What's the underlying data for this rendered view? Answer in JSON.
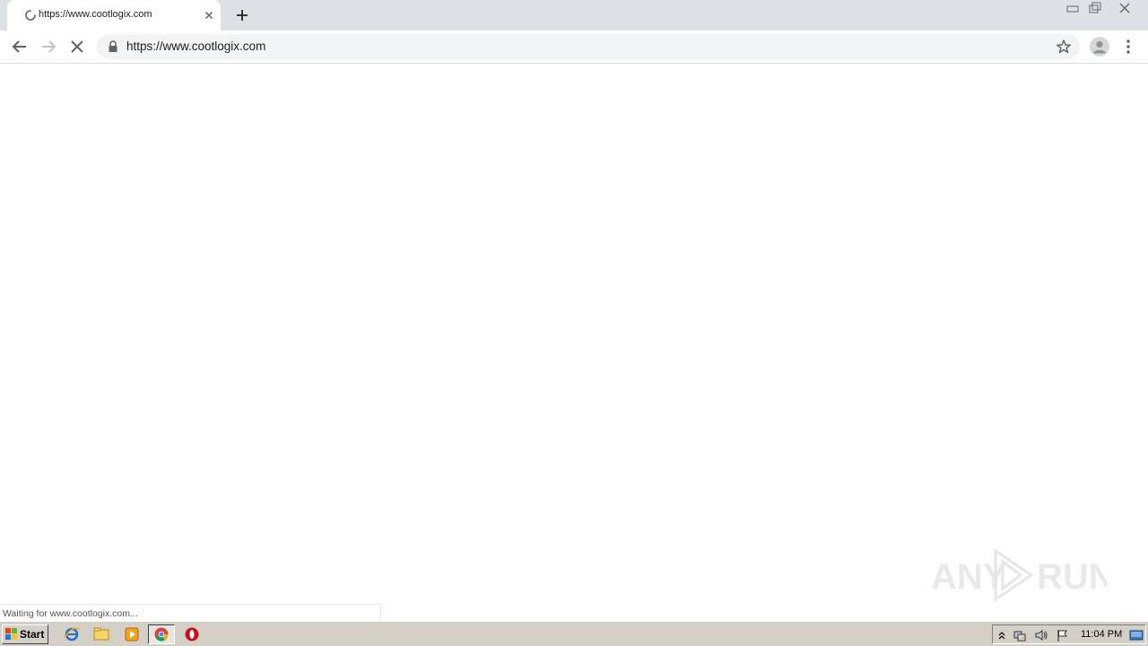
{
  "tab": {
    "title": "https://www.cootlogix.com",
    "loading": true
  },
  "toolbar": {
    "url": "https://www.cootlogix.com"
  },
  "status": {
    "text": "Waiting for www.cootlogix.com..."
  },
  "taskbar": {
    "start_label": "Start",
    "clock": "11:04 PM",
    "pinned": [
      "ie-icon",
      "explorer-icon",
      "media-player-icon",
      "chrome-icon",
      "opera-icon"
    ]
  },
  "watermark": {
    "text_left": "ANY",
    "text_right": "RUN"
  },
  "colors": {
    "tabstrip": "#dee1e6",
    "omnibox": "#f1f3f4",
    "taskbar": "#d4d0c8"
  }
}
